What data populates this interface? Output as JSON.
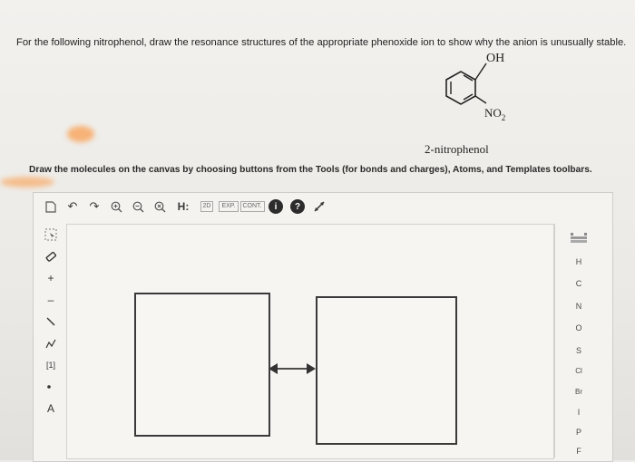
{
  "question": "For the following nitrophenol, draw the resonance structures of the appropriate phenoxide ion to show why the anion is unusually stable.",
  "molecule": {
    "oh_label": "OH",
    "no2_label": "NO",
    "no2_sub": "2",
    "caption": "2-nitrophenol"
  },
  "instruction": "Draw the molecules on the canvas by choosing buttons from the Tools (for bonds and charges), Atoms, and Templates toolbars.",
  "toolbar": {
    "h_label": "H:",
    "label_2d": "2D",
    "label_exp": "EXP.",
    "label_cont": "CONT.",
    "info_label": "i",
    "help_label": "?"
  },
  "left_tools": {
    "plus": "+",
    "minus": "–",
    "charge": "[1]",
    "atom_a": "A"
  },
  "atoms": [
    "H",
    "C",
    "N",
    "O",
    "S",
    "Cl",
    "Br",
    "I",
    "P",
    "F"
  ],
  "colors": {
    "accent": "#2c2c2c",
    "highlight": "#f6b277"
  }
}
